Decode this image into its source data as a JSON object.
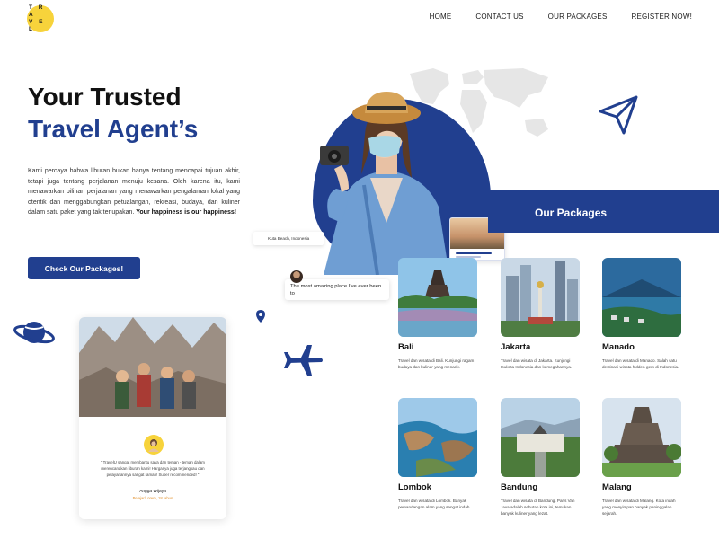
{
  "brand": {
    "logo_line1": "T R A",
    "logo_line2": "V E L",
    "accent": "#213f8f",
    "logo_color": "#f7d33b"
  },
  "nav": {
    "items": [
      "HOME",
      "CONTACT US",
      "OUR PACKAGES",
      "REGISTER NOW!"
    ]
  },
  "hero": {
    "title_line1": "Your Trusted",
    "title_line2": "Travel Agent’s",
    "description": "Kami percaya bahwa liburan bukan hanya tentang mencapai tujuan akhir, tetapi juga tentang perjalanan menuju kesana. Oleh karena itu, kami menawarkan pilihan perjalanan yang menawarkan pengalaman lokal yang otentik dan menggabungkan petualangan, rekreasi, budaya, dan kuliner dalam satu paket yang tak terlupakan.",
    "description_bold": "Your happiness is our happiness!",
    "cta_label": "Check Our Packages!"
  },
  "floating": {
    "location_tag": "Kuta Beach, Indonesia",
    "chat_message": "The most amazing place I’ve ever been to"
  },
  "packages": {
    "heading": "Our Packages",
    "items": [
      {
        "name": "Bali",
        "desc": "Travel dan wisata di Bali. Kunjungi ragam budaya dan kuliner yang menarik."
      },
      {
        "name": "Jakarta",
        "desc": "Travel dan wisata di Jakarta. Kunjungi Ibukota Indonesia dan kemegahannya."
      },
      {
        "name": "Manado",
        "desc": "Travel dan wisata di Manado. Salah satu destinasi wisata hidden-gem di Indonesia."
      },
      {
        "name": "Lombok",
        "desc": "Travel dan wisata di Lombok. Banyak pemandangan alam yang sangat indah"
      },
      {
        "name": "Bandung",
        "desc": "Travel dan wisata di Bandung. Paris Van Java adalah sebutan kota ini, temukan banyak kuliner yang lezat."
      },
      {
        "name": "Malang",
        "desc": "Travel dan wisata di Malang. Kota indah yang menyimpan banyak peninggalan sejarah."
      }
    ]
  },
  "testimonial": {
    "quote": "“ TravelU sangat membantu saya dan teman - teman dalam merencanakan liburan kami! Harganya juga terjangkau dan pelayanannya sangat ramah! Super recommended! ”",
    "author": "Angga Wijaya",
    "role": "Pelajar/Lorem, 18 tahun"
  }
}
